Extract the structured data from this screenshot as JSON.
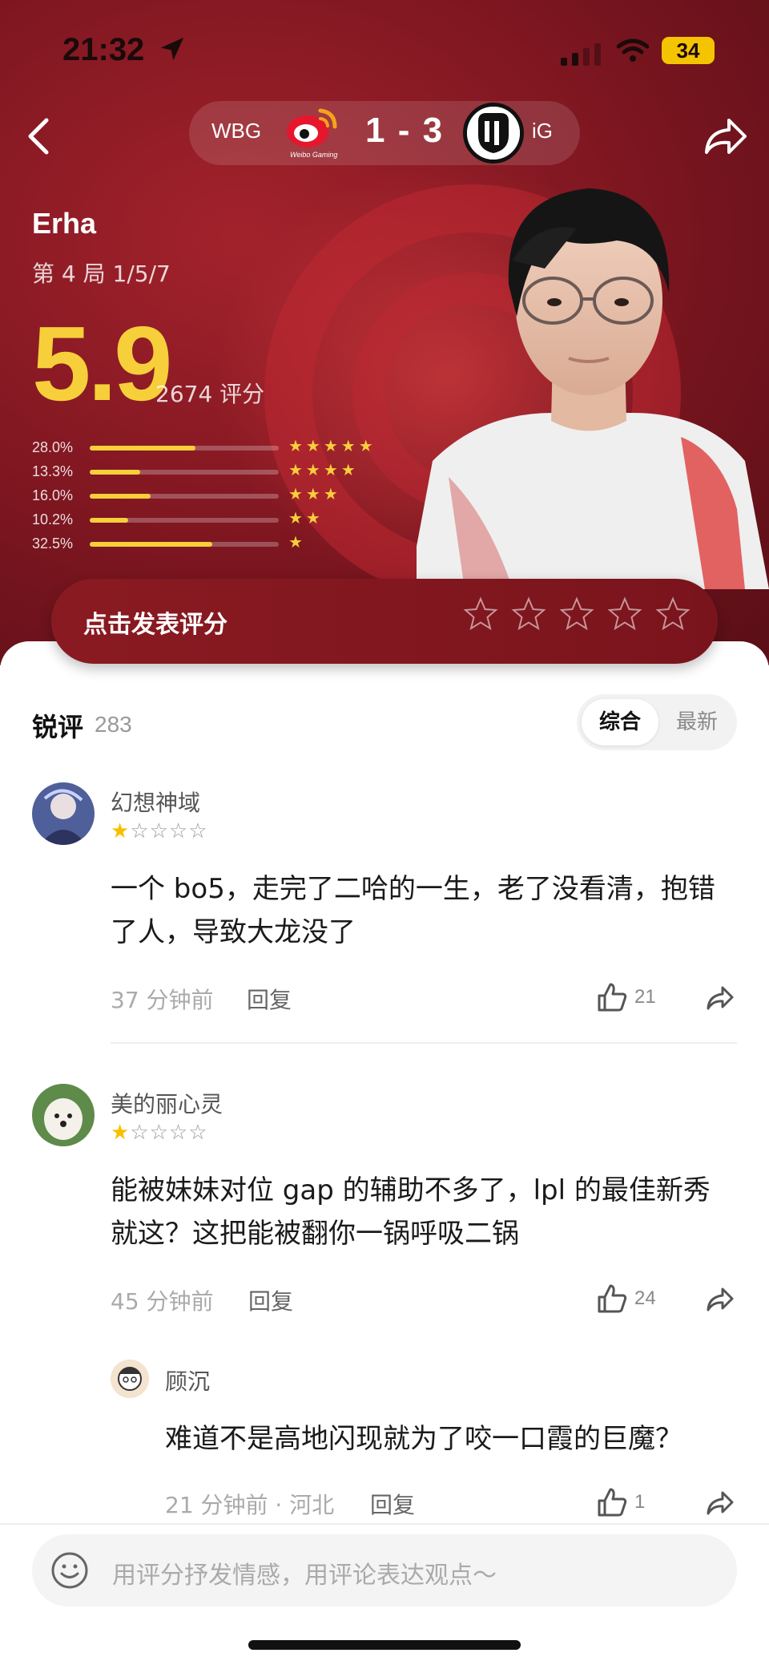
{
  "status_bar": {
    "time": "21:32",
    "battery": "34"
  },
  "match": {
    "team_left": "WBG",
    "team_left_logo_text": "Weibo Gaming",
    "score": "1 - 3",
    "team_right": "iG"
  },
  "player": {
    "name": "Erha",
    "game_info": "第 4 局  1/5/7",
    "rating": "5.9",
    "rating_count": "2674 评分",
    "distribution": [
      {
        "pct": "28.0%",
        "value": 0.28,
        "stars": "★★★★★"
      },
      {
        "pct": "13.3%",
        "value": 0.133,
        "stars": "★★★★"
      },
      {
        "pct": "16.0%",
        "value": 0.16,
        "stars": "★★★"
      },
      {
        "pct": "10.2%",
        "value": 0.102,
        "stars": "★★"
      },
      {
        "pct": "32.5%",
        "value": 0.325,
        "stars": "★"
      }
    ]
  },
  "rate_action": {
    "label": "点击发表评分",
    "star_count": 5
  },
  "comments_section": {
    "title": "锐评",
    "count": "283",
    "sort_active": "综合",
    "sort_other": "最新"
  },
  "comments": [
    {
      "user": "幻想神域",
      "rating": 1,
      "stars_on": "★",
      "stars_off": "☆☆☆☆",
      "text": "一个 bo5，走完了二哈的一生，老了没看清，抱错了人，导致大龙没了",
      "time": "37 分钟前",
      "reply": "回复",
      "likes": "21"
    },
    {
      "user": "美的丽心灵",
      "rating": 1,
      "stars_on": "★",
      "stars_off": "☆☆☆☆",
      "text": "能被妹妹对位 gap 的辅助不多了，lpl 的最佳新秀就这？这把能被翻你一锅呼吸二锅",
      "time": "45 分钟前",
      "reply": "回复",
      "likes": "24",
      "sub_reply": {
        "user": "顾沉",
        "text": "难道不是高地闪现就为了咬一口霞的巨魔？",
        "time": "21 分钟前 · 河北",
        "reply": "回复",
        "likes": "1"
      }
    }
  ],
  "input": {
    "placeholder": "用评分抒发情感，用评论表达观点～"
  },
  "icons": {
    "back": "chevron-left-icon",
    "share": "share-icon",
    "like": "thumbs-up-icon",
    "forward": "forward-icon",
    "emoji": "emoji-icon",
    "location": "location-arrow-icon"
  },
  "colors": {
    "accent": "#f6cf3a",
    "hero": "#8a1a22",
    "star": "#f6c000"
  }
}
